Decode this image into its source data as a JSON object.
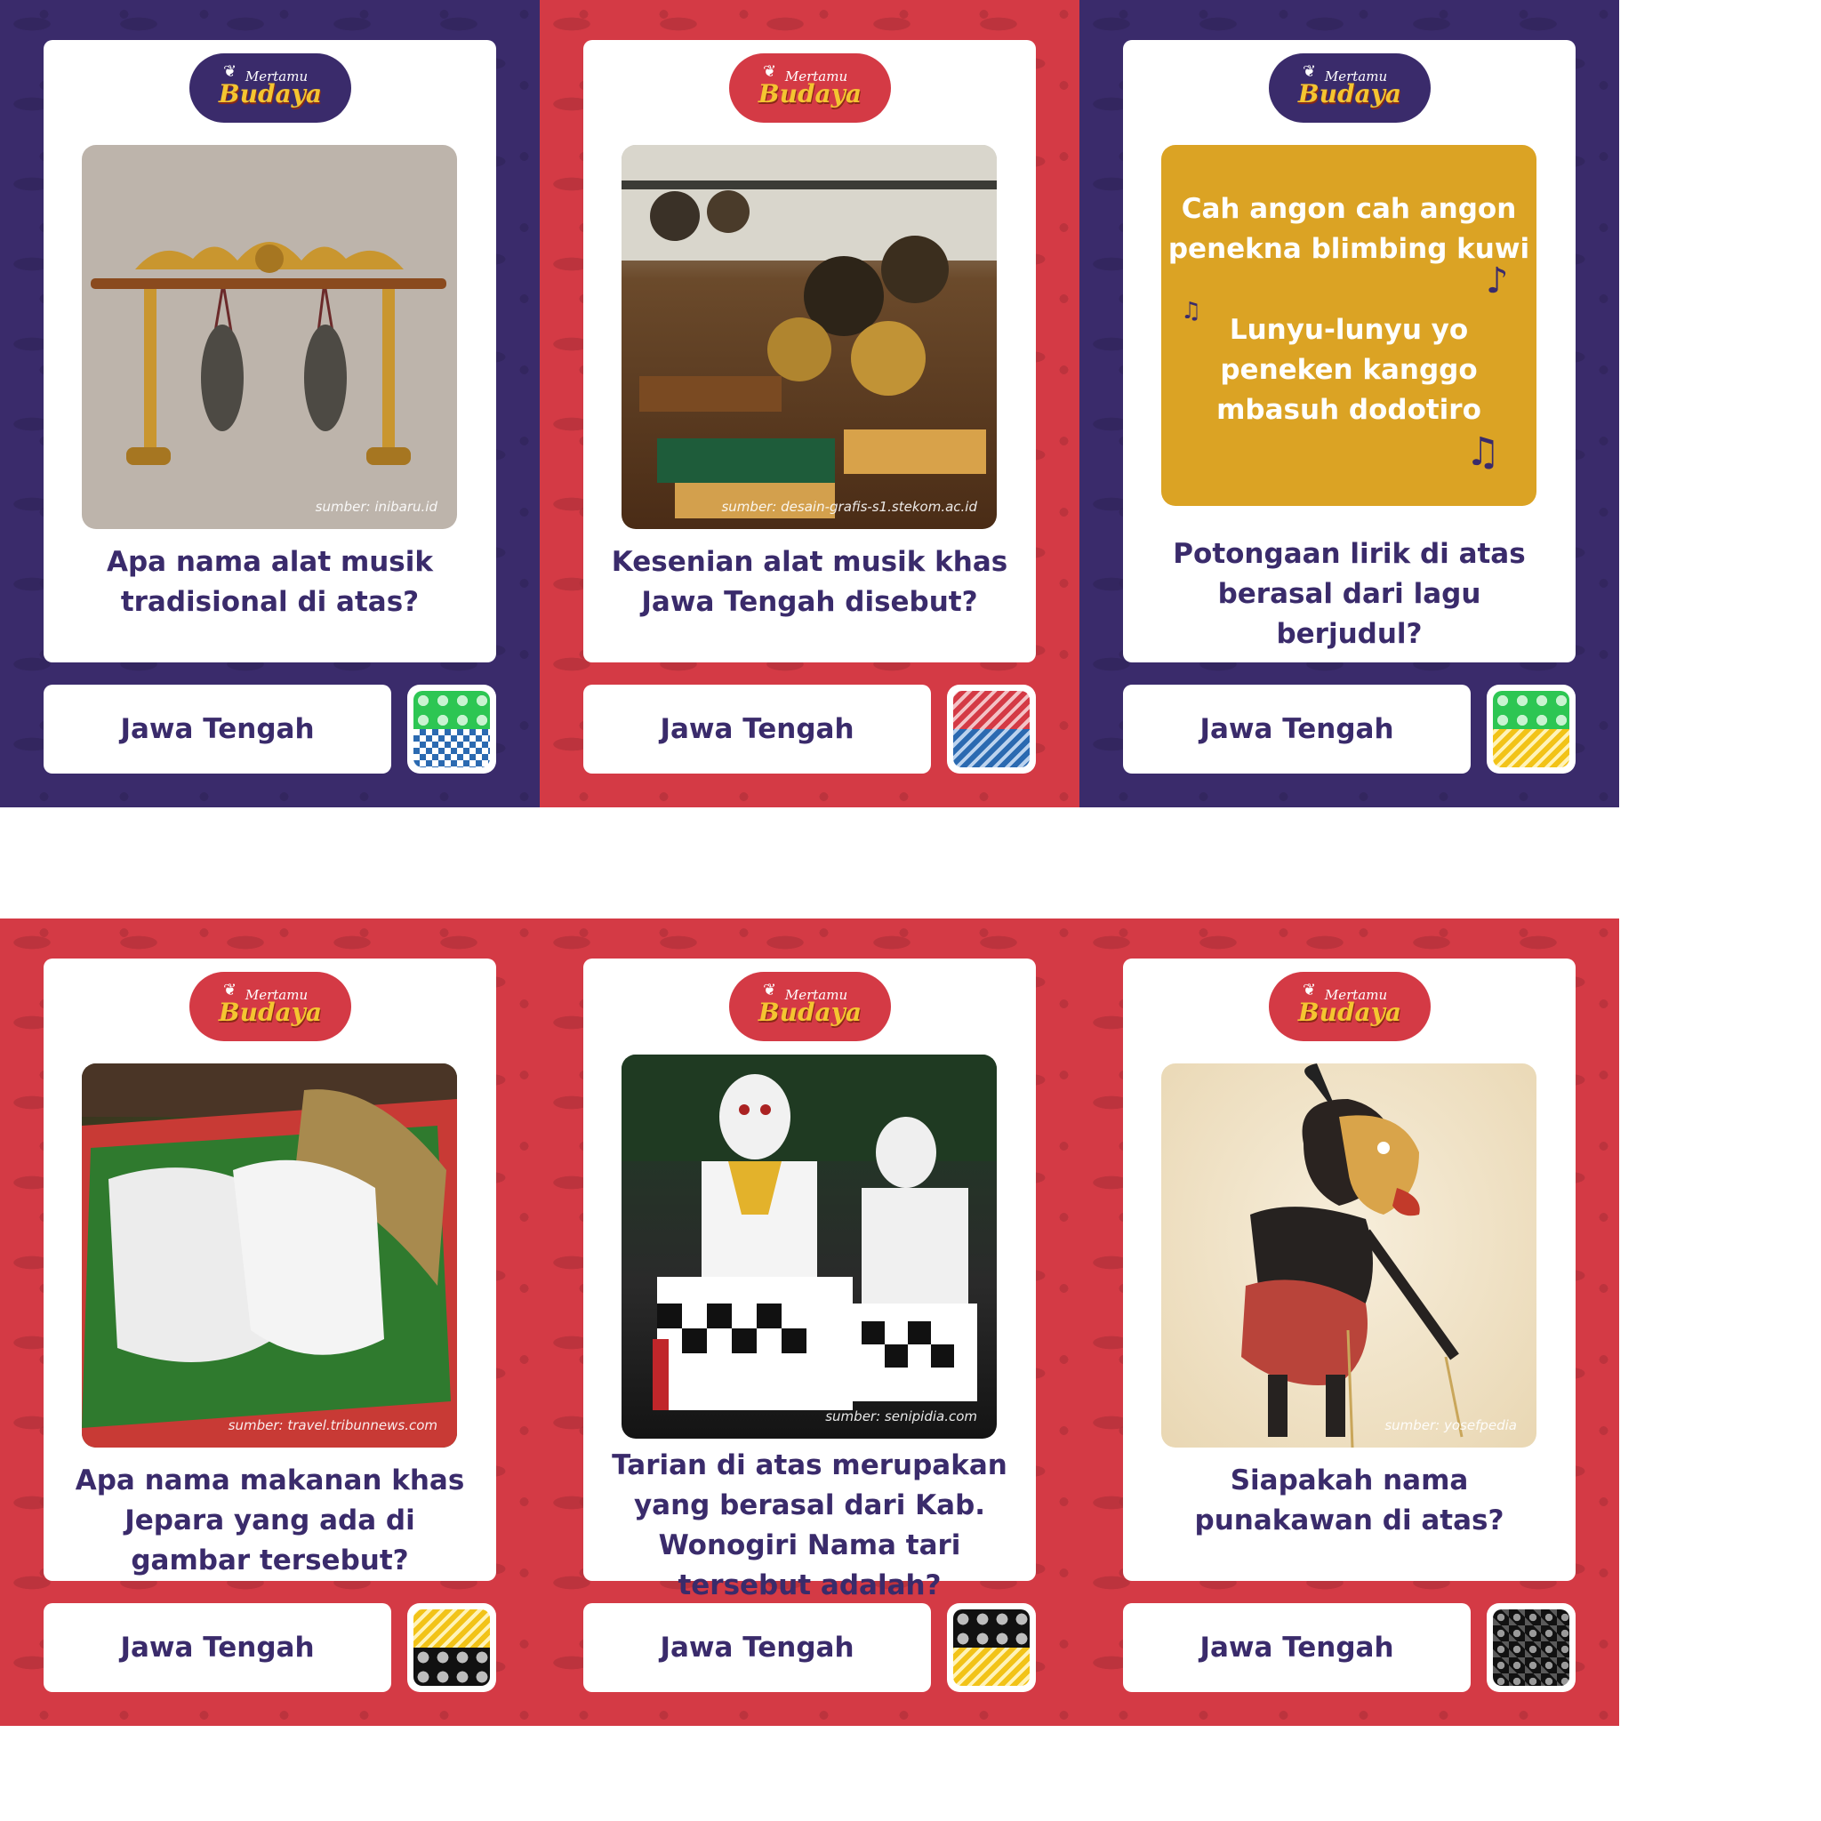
{
  "brand": {
    "top": "Mertamu",
    "bottom": "Budaya"
  },
  "cards": [
    {
      "theme": "purple",
      "question": "Apa nama alat musik tradisional di atas?",
      "credit": "sumber: inibaru.id",
      "region": "Jawa Tengah",
      "illustration": "gong-stand",
      "swatch": [
        "green-dots",
        "blue-check"
      ]
    },
    {
      "theme": "red",
      "question": "Kesenian alat musik khas Jawa Tengah disebut?",
      "credit": "sumber: desain-grafis-s1.stekom.ac.id",
      "region": "Jawa Tengah",
      "illustration": "gamelan-set",
      "swatch": [
        "red-stripe",
        "blue-stripe"
      ]
    },
    {
      "theme": "purple",
      "question": "Potongaan lirik di atas berasal dari lagu berjudul?",
      "lyric_lines_1": [
        "Cah angon cah angon",
        "penekna blimbing kuwi"
      ],
      "lyric_lines_2": [
        "Lunyu-lunyu yo",
        "peneken kanggo",
        "mbasuh dodotiro"
      ],
      "region": "Jawa Tengah",
      "illustration": "lyric-card",
      "swatch": [
        "green-dots",
        "yellow-stripe"
      ]
    },
    {
      "theme": "red",
      "question": "Apa nama makanan khas Jepara yang ada di gambar tersebut?",
      "credit": "sumber: travel.tribunnews.com",
      "region": "Jawa Tengah",
      "illustration": "rice-cake-food",
      "swatch": [
        "yellow-stripe",
        "black-dots"
      ]
    },
    {
      "theme": "red",
      "question": "Tarian di atas merupakan yang berasal dari Kab. Wonogiri Nama tari tersebut adalah?",
      "credit": "sumber: senipidia.com",
      "region": "Jawa Tengah",
      "illustration": "masked-dancers",
      "swatch": [
        "black-dots",
        "yellow-stripe"
      ]
    },
    {
      "theme": "red",
      "question": "Siapakah nama punakawan di atas?",
      "credit": "sumber: yosefpedia",
      "region": "Jawa Tengah",
      "illustration": "wayang-puppet",
      "swatch": [
        "black-check-dots"
      ]
    }
  ],
  "colors": {
    "purple": "#3a2b6b",
    "red": "#d43a45",
    "gold": "#dba324",
    "text": "#3a2b6b"
  }
}
